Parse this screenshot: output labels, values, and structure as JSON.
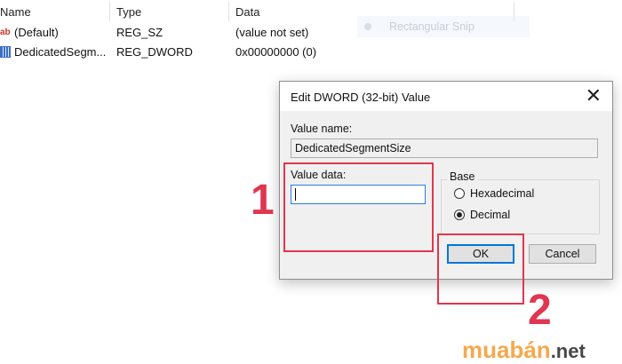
{
  "registry": {
    "columns": [
      "Name",
      "Type",
      "Data"
    ],
    "rows": [
      {
        "icon": "string-value-icon",
        "name": "(Default)",
        "type": "REG_SZ",
        "data": "(value not set)"
      },
      {
        "icon": "binary-value-icon",
        "name": "DedicatedSegm...",
        "type": "REG_DWORD",
        "data": "0x00000000 (0)"
      }
    ]
  },
  "snip_toolbar": {
    "label": "Rectangular Snip"
  },
  "dialog": {
    "title": "Edit DWORD (32-bit) Value",
    "close_glyph": "✕",
    "value_name_label": "Value name:",
    "value_name": "DedicatedSegmentSize",
    "value_data_label": "Value data:",
    "value_data": "",
    "base_label": "Base",
    "base_options": [
      {
        "label": "Hexadecimal",
        "selected": false
      },
      {
        "label": "Decimal",
        "selected": true
      }
    ],
    "ok_label": "OK",
    "cancel_label": "Cancel"
  },
  "annotations": {
    "step1": "1",
    "step2": "2",
    "color": "#e0364f"
  },
  "watermark": {
    "brand": "muabán",
    "suffix": ".net"
  }
}
